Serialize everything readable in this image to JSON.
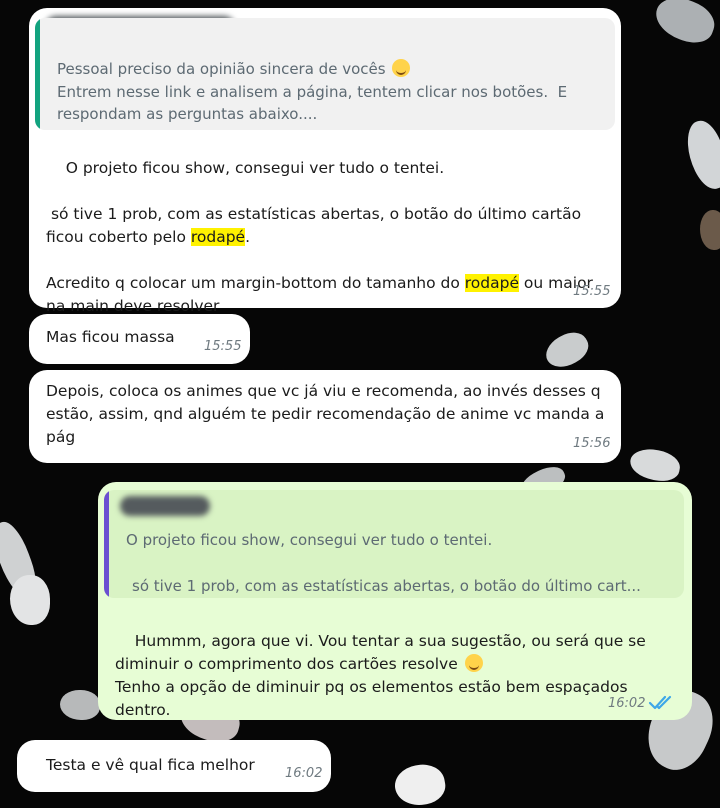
{
  "colors": {
    "incoming_bubble": "#ffffff",
    "outgoing_bubble": "#e7fdd5",
    "quote_bar_green": "#12a37f",
    "quote_bar_purple": "#6b4fd1",
    "read_ticks": "#3ea7e8",
    "highlight": "#fff200"
  },
  "messages": [
    {
      "quote": {
        "text": "Pessoal preciso da opinião sincera de vocês ",
        "text2": "Entrem nesse link e analisem a página, tentem clicar nos botões.  E respondam as perguntas abaixo...."
      },
      "p1": "O projeto ficou show, consegui ver tudo o tentei.",
      "p2": " só tive 1 prob, com as estatísticas abertas, o botão do último cartão ficou coberto pelo ",
      "p2_hl": "rodapé",
      "p2_end": ".",
      "p3_a": "Acredito q colocar um margin-bottom do tamanho do ",
      "p3_hl": "rodapé",
      "p3_b": " ou maior na main deve resolver",
      "time": "15:55"
    },
    {
      "text": "Mas ficou massa",
      "time": "15:55"
    },
    {
      "text": "Depois, coloca os animes que vc já viu e recomenda, ao invés desses q estão, assim, qnd alguém te pedir recomendação de anime vc manda a pág",
      "time": "15:56"
    },
    {
      "quote": {
        "line1": "O projeto ficou show, consegui ver tudo o tentei.",
        "line2": "só tive 1 prob, com as estatísticas abertas, o botão do último cart..."
      },
      "text1": "Hummm, agora que vi. Vou tentar a sua sugestão, ou será que se diminuir o comprimento dos cartões resolve ",
      "text2": "Tenho a opção de diminuir pq os elementos estão bem espaçados dentro.",
      "time": "16:02"
    },
    {
      "text": "Testa e vê qual fica melhor",
      "time": "16:02"
    }
  ]
}
